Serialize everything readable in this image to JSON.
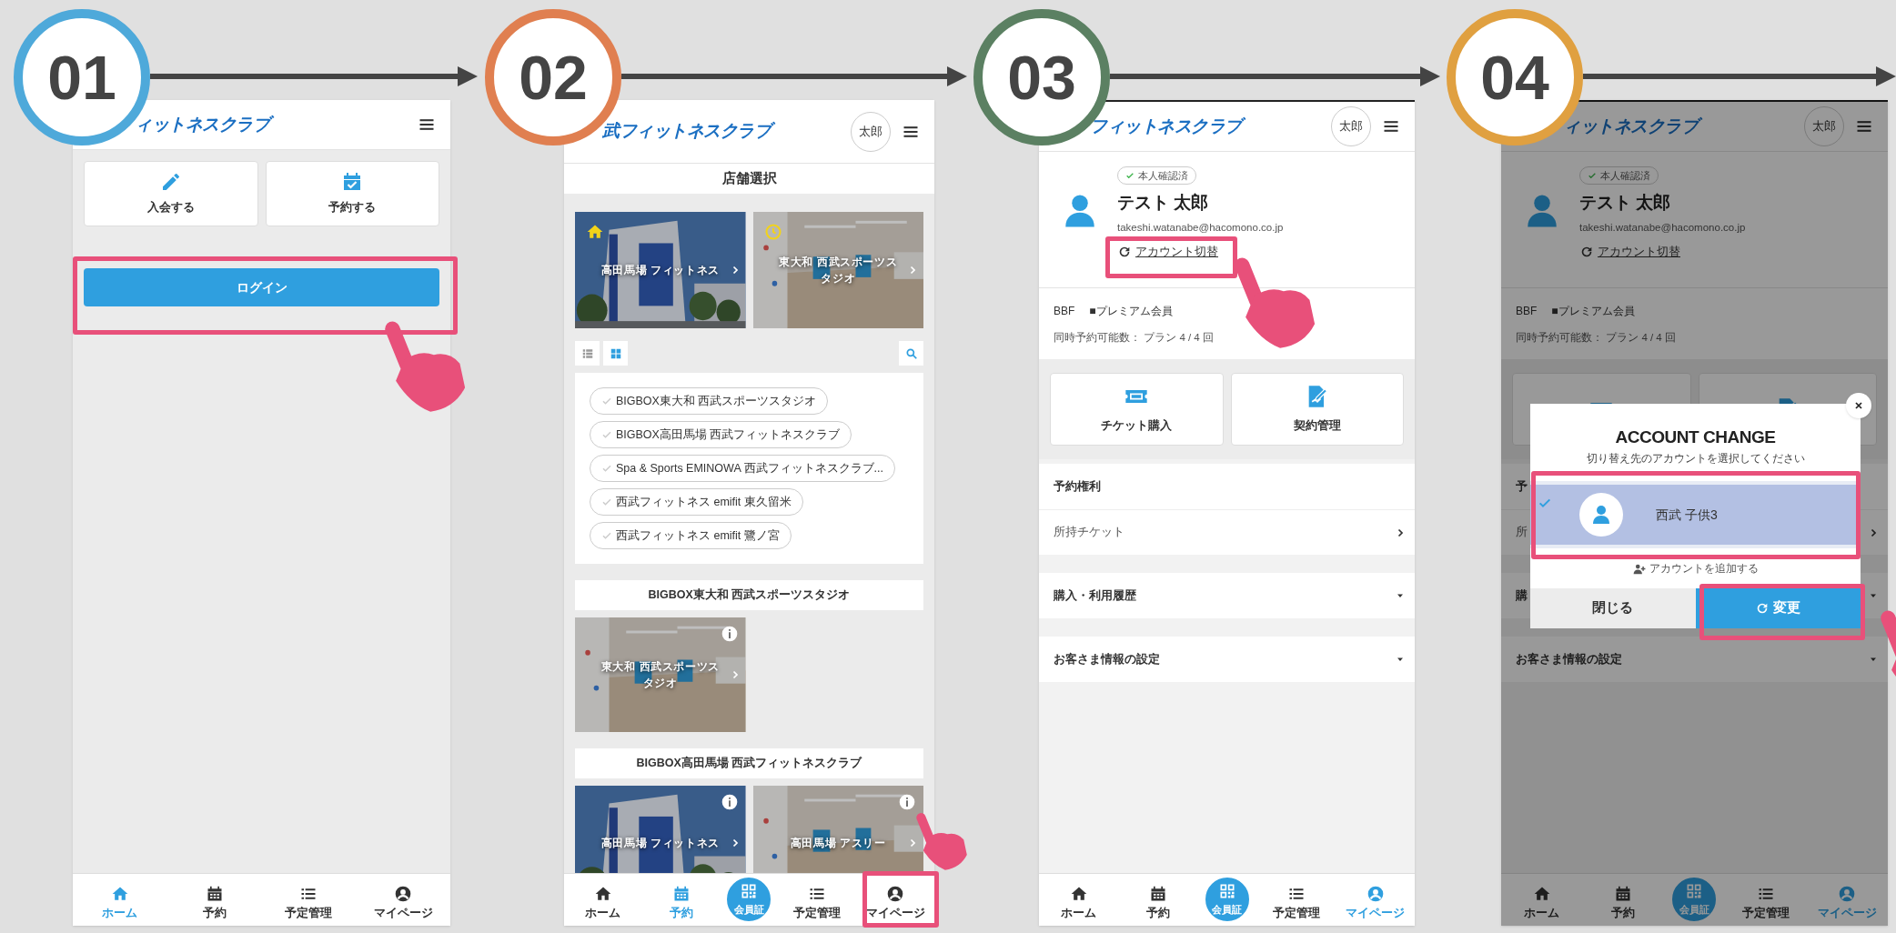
{
  "steps": [
    {
      "number": "01",
      "color": "#4ea9da",
      "screen": {
        "kind": "home",
        "logo": "ィットネスクラブ",
        "actions": [
          {
            "label": "入会する",
            "kind": "pencil"
          },
          {
            "label": "予約する",
            "kind": "calcheck"
          }
        ],
        "login": "ログイン",
        "nav": [
          {
            "label": "ホーム",
            "kind": "home",
            "selected": true
          },
          {
            "label": "予約",
            "kind": "calendar",
            "selected": false
          },
          {
            "label": "予定管理",
            "kind": "list",
            "selected": false
          },
          {
            "label": "マイページ",
            "kind": "user",
            "selected": false
          }
        ]
      }
    },
    {
      "number": "02",
      "color": "#e07f50",
      "screen": {
        "kind": "store_select",
        "logo": "武フィットネスクラブ",
        "avatar": "太郎",
        "title": "店舗選択",
        "featured": [
          {
            "label": "高田馬場 フィットネス",
            "kind": "home"
          },
          {
            "label": "東大和 西武スポーツスタジオ",
            "kind": "clock"
          }
        ],
        "toggles": [
          {
            "kind": "listview",
            "selected": false
          },
          {
            "kind": "grid",
            "selected": true
          }
        ],
        "chips": [
          "BIGBOX東大和 西武スポーツスタジオ",
          "BIGBOX高田馬場 西武フィットネスクラブ",
          "Spa & Sports EMINOWA 西武フィットネスクラブ...",
          "西武フィットネス emifit 東久留米",
          "西武フィットネス emifit 鷺ノ宮"
        ],
        "sections": [
          {
            "title": "BIGBOX東大和 西武スポーツスタジオ",
            "cards": [
              "東大和 西武スポーツスタジオ"
            ]
          },
          {
            "title": "BIGBOX高田馬場 西武フィットネスクラブ",
            "cards": [
              "高田馬場 フィットネス",
              "高田馬場 アスリー"
            ]
          }
        ],
        "nav": [
          {
            "label": "ホーム",
            "kind": "home",
            "selected": false
          },
          {
            "label": "予約",
            "kind": "calendar",
            "selected": true
          },
          {
            "label": "会員証",
            "kind": "qr"
          },
          {
            "label": "予定管理",
            "kind": "list",
            "selected": false
          },
          {
            "label": "マイページ",
            "kind": "user",
            "selected": false
          }
        ]
      }
    },
    {
      "number": "03",
      "color": "#5b8062",
      "screen": {
        "kind": "mypage",
        "logo": "フィットネスクラブ",
        "avatar": "太郎",
        "badge": "本人確認済",
        "name": "テスト 太郎",
        "email": "takeshi.watanabe@hacomono.co.jp",
        "switch": "アカウント切替",
        "plan": [
          "BBF",
          "■プレミアム会員"
        ],
        "quota": "同時予約可能数： プラン 4 / 4 回",
        "cards": [
          {
            "label": "チケット購入",
            "kind": "ticket"
          },
          {
            "label": "契約管理",
            "kind": "contract"
          }
        ],
        "rows": [
          {
            "label": "予約権利",
            "kind": "header"
          },
          {
            "label": "所持チケット",
            "kind": "link"
          },
          {
            "label": "購入・利用履歴",
            "kind": "dropdown"
          },
          {
            "label": "お客さま情報の設定",
            "kind": "dropdown"
          }
        ],
        "nav": [
          {
            "label": "ホーム",
            "kind": "home",
            "selected": false
          },
          {
            "label": "予約",
            "kind": "calendar",
            "selected": false
          },
          {
            "label": "会員証",
            "kind": "qr"
          },
          {
            "label": "予定管理",
            "kind": "list",
            "selected": false
          },
          {
            "label": "マイページ",
            "kind": "user",
            "selected": true
          }
        ]
      }
    },
    {
      "number": "04",
      "color": "#e0a040",
      "screen": {
        "kind": "mypage",
        "logo": "ィットネスクラブ",
        "avatar": "太郎",
        "badge": "本人確認済",
        "name": "テスト 太郎",
        "email": "takeshi.watanabe@hacomono.co.jp",
        "switch": "アカウント切替",
        "plan": [
          "BBF",
          "■プレミアム会員"
        ],
        "quota": "同時予約可能数： プラン 4 / 4 回",
        "cards": [
          {
            "kind": "ticket"
          },
          {
            "kind": "contract"
          }
        ],
        "rows": [
          {
            "label": "予",
            "kind": "header"
          },
          {
            "label": "所",
            "kind": "link"
          },
          {
            "label": "購",
            "kind": "dropdown"
          },
          {
            "label": "お客さま情報の設定",
            "kind": "dropdown"
          }
        ],
        "nav": [
          {
            "label": "ホーム",
            "kind": "home",
            "selected": false
          },
          {
            "label": "予約",
            "kind": "calendar",
            "selected": false
          },
          {
            "label": "会員証",
            "kind": "qr"
          },
          {
            "label": "予定管理",
            "kind": "list",
            "selected": false
          },
          {
            "label": "マイページ",
            "kind": "user",
            "selected": true
          }
        ],
        "modal": {
          "title": "ACCOUNT CHANGE",
          "subtitle": "切り替え先のアカウントを選択してください",
          "accounts": [
            {
              "name": "西武 子供3",
              "selected": true
            }
          ],
          "add": "アカウントを追加する",
          "close": "閉じる",
          "confirm": "変更"
        }
      }
    }
  ]
}
